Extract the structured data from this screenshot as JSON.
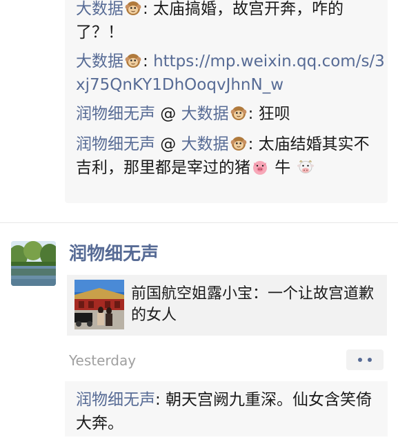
{
  "comments": [
    {
      "user": "大数据",
      "has_monkey": true,
      "text": ": 太庙搞婚，故宫开奔，咋的了？！"
    },
    {
      "user": "大数据",
      "has_monkey": true,
      "text": ": ",
      "link": "https://mp.weixin.qq.com/s/3xj75QnKY1DhOoqvJhnN_w"
    },
    {
      "user": "润物细无声",
      "reply_marker": " @ ",
      "reply_to": "大数据",
      "has_monkey": true,
      "text": ": 狂呗"
    },
    {
      "user": "润物细无声",
      "reply_marker": " @ ",
      "reply_to": "大数据",
      "has_monkey": true,
      "text": ": 太庙结婚其实不吉利，那里都是宰过的猪",
      "tail_emojis": [
        "pig-face-emoji",
        "cow-face-emoji"
      ],
      "tail_text": " 牛 "
    }
  ],
  "post": {
    "author": "润物细无声",
    "share_title": "前国航空姐露小宝：一个让故宫道歉的女人",
    "time": "Yesterday",
    "more_icon": "more-dots-icon"
  },
  "post_comments": [
    {
      "user": "润物细无声",
      "text": ": 朝天宫阙九重深。仙女含笑倚大奔。"
    }
  ],
  "colors": {
    "username": "#576b95",
    "text": "#1a1a1a",
    "time": "#a0a0a0",
    "comment_bg": "#f7f7f7",
    "card_bg": "#f2f2f2"
  }
}
